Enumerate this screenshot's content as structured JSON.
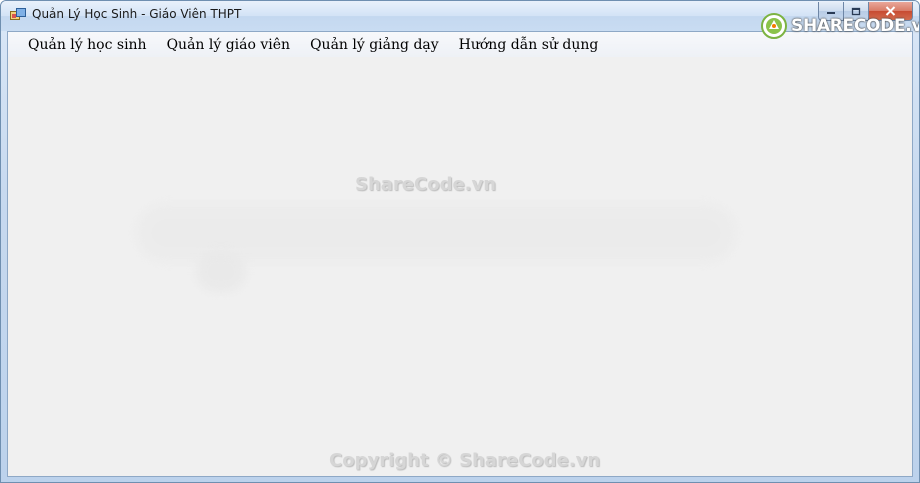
{
  "window": {
    "title": "Quản Lý Học Sinh - Giáo Viên THPT"
  },
  "title_buttons": {
    "minimize_icon": "minimize-icon",
    "maximize_icon": "maximize-icon",
    "close_icon": "close-icon"
  },
  "brand": {
    "logo_text": "SHARECODE.vn",
    "logo_icon": "sharecode-logo-icon"
  },
  "menu": {
    "items": [
      {
        "label": "Quản lý học sinh"
      },
      {
        "label": "Quản lý giáo viên"
      },
      {
        "label": "Quản lý giảng dạy"
      },
      {
        "label": "Hướng dẫn sử dụng"
      }
    ]
  },
  "watermarks": {
    "center": "ShareCode.vn",
    "copyright": "Copyright © ShareCode.vn"
  }
}
